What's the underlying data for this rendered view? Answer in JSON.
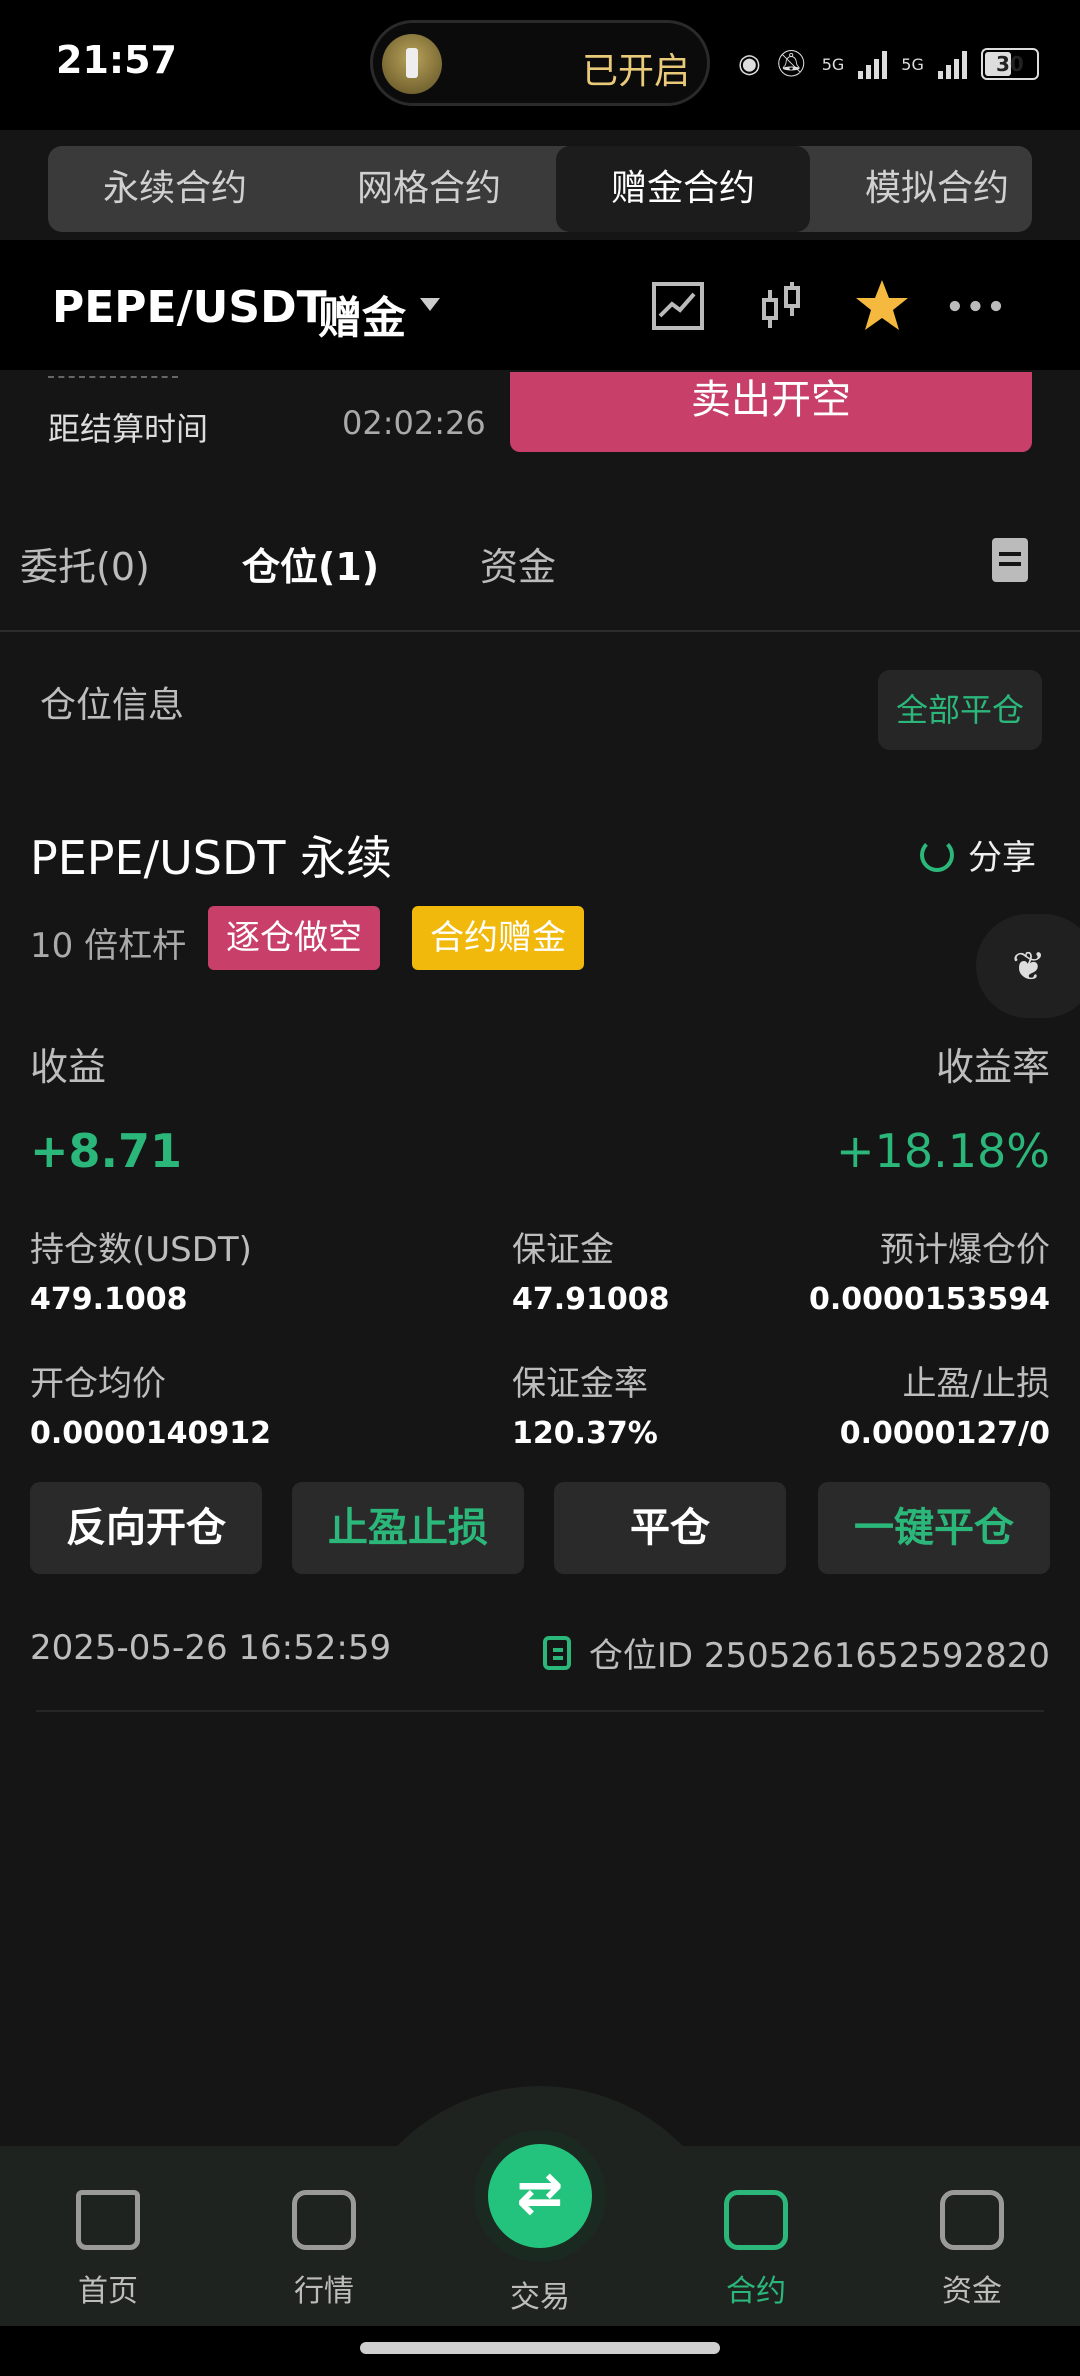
{
  "status_bar": {
    "time": "21:57",
    "island_text": "已开启",
    "battery": "30",
    "net_labels": [
      "5G",
      "5G"
    ]
  },
  "top_tabs": [
    {
      "label": "永续合约",
      "active": false
    },
    {
      "label": "网格合约",
      "active": false
    },
    {
      "label": "赠金合约",
      "active": true
    },
    {
      "label": "模拟合约",
      "active": false
    }
  ],
  "header": {
    "pair": "PEPE/USDT",
    "mode": "赠金"
  },
  "settlement": {
    "label": "距结算时间",
    "countdown": "02:02:26"
  },
  "sell_button": "卖出开空",
  "list_tabs": [
    "委托(0)",
    "仓位(1)",
    "资金"
  ],
  "position_section": {
    "title": "仓位信息",
    "close_all": "全部平仓"
  },
  "position": {
    "title": "PEPE/USDT 永续",
    "share": "分享",
    "leverage": "10 倍杠杆",
    "tag_mode": "逐仓做空",
    "tag_bonus": "合约赠金",
    "pnl_label": "收益",
    "pnl_rate_label": "收益率",
    "pnl": "+8.71",
    "pnl_rate": "+18.18%",
    "fields": {
      "size_label": "持仓数(USDT)",
      "size": "479.1008",
      "margin_label": "保证金",
      "margin": "47.91008",
      "liq_label": "预计爆仓价",
      "liq": "0.0000153594",
      "entry_label": "开仓均价",
      "entry": "0.0000140912",
      "margin_ratio_label": "保证金率",
      "margin_ratio": "120.37%",
      "tpsl_label": "止盈/止损",
      "tpsl": "0.0000127/0"
    },
    "actions": [
      "反向开仓",
      "止盈止损",
      "平仓",
      "一键平仓"
    ],
    "timestamp": "2025-05-26 16:52:59",
    "position_id": "仓位ID 2505261652592820"
  },
  "bottom_nav": [
    {
      "label": "首页",
      "icon": "home-icon"
    },
    {
      "label": "行情",
      "icon": "market-icon"
    },
    {
      "label": "交易",
      "icon": "swap-icon"
    },
    {
      "label": "合约",
      "icon": "contract-icon"
    },
    {
      "label": "资金",
      "icon": "wallet-icon"
    }
  ],
  "colors": {
    "green": "#2bb67a",
    "red": "#c8406a",
    "yellow": "#f0b90b"
  }
}
